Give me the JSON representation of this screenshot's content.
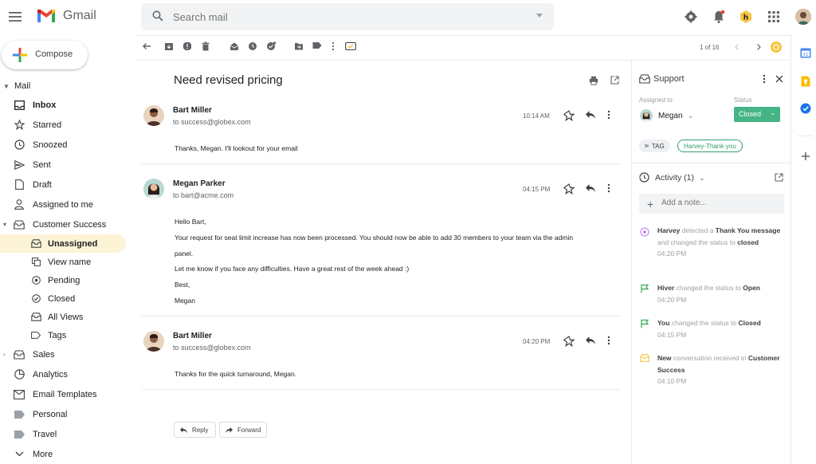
{
  "header": {
    "brand": "Gmail",
    "search_placeholder": "Search mail"
  },
  "sidebar": {
    "compose": "Compose",
    "section_label": "Mail",
    "items": [
      {
        "label": "Inbox"
      },
      {
        "label": "Starred"
      },
      {
        "label": "Snoozed"
      },
      {
        "label": "Sent"
      },
      {
        "label": "Draft"
      },
      {
        "label": "Assigned to me"
      },
      {
        "label": "Customer Success"
      }
    ],
    "sub_items": [
      {
        "label": "Unassigned"
      },
      {
        "label": "View name"
      },
      {
        "label": "Pending"
      },
      {
        "label": "Closed"
      },
      {
        "label": "All Views"
      },
      {
        "label": "Tags"
      }
    ],
    "bottom_items": [
      {
        "label": "Sales"
      },
      {
        "label": "Analytics"
      },
      {
        "label": "Email Templates"
      },
      {
        "label": "Personal"
      },
      {
        "label": "Travel"
      },
      {
        "label": "More"
      }
    ]
  },
  "toolbar": {
    "pager": "1 of 16"
  },
  "thread": {
    "subject": "Need revised pricing",
    "messages": [
      {
        "from": "Bart Miller",
        "to": "to success@globex.com",
        "time": "10:14 AM",
        "body": [
          "Thanks, Megan. I'll lookout for your email"
        ]
      },
      {
        "from": "Megan Parker",
        "to": "to bart@acme.com",
        "time": "04:15 PM",
        "body": [
          "Hello Bart,",
          "Your request for seat limit increase has now been processed. You should now be able to add 30 members to your team via the admin",
          "panel.",
          "Let me know if you face any difficulties. Have a great rest of the week ahead :)",
          "Best,",
          "Megan"
        ]
      },
      {
        "from": "Bart Miller",
        "to": "to success@globex.com",
        "time": "04:20 PM",
        "body": [
          "Thanks for the quick turnaround, Megan."
        ]
      }
    ],
    "reply": "Reply",
    "forward": "Forward"
  },
  "panel": {
    "title": "Support",
    "assigned_label": "Assigned to",
    "assignee": "Megan",
    "status_label": "Status",
    "status": "Closed",
    "tag_label": "TAG",
    "tag": "Harvey-Thank-you",
    "activity_title": "Activity (1)",
    "note_placeholder": "Add a note...",
    "activities": [
      {
        "p1": "Harvey",
        "p2": " detected a ",
        "p3": "Thank You message",
        "p4": " and changed the status to ",
        "p5": "closed",
        "time": "04:20 PM"
      },
      {
        "p1": "Hiver",
        "p2": " changed the status to ",
        "p3": "Open",
        "time": "04:20 PM"
      },
      {
        "p1": "You",
        "p2": " changed the status to ",
        "p3": "Closed",
        "time": "04:15 PM"
      },
      {
        "p1": "New",
        "p2": " conversation received in ",
        "p3": "Customer Success",
        "time": "04:10 PM"
      }
    ]
  },
  "colors": {
    "status_green": "#45b486",
    "active_bg": "#fdf3d7",
    "tag_green": "#2e9f6b"
  },
  "icons": {
    "rail": [
      "calendar-icon",
      "keep-icon",
      "tasks-icon",
      "add-icon"
    ]
  }
}
